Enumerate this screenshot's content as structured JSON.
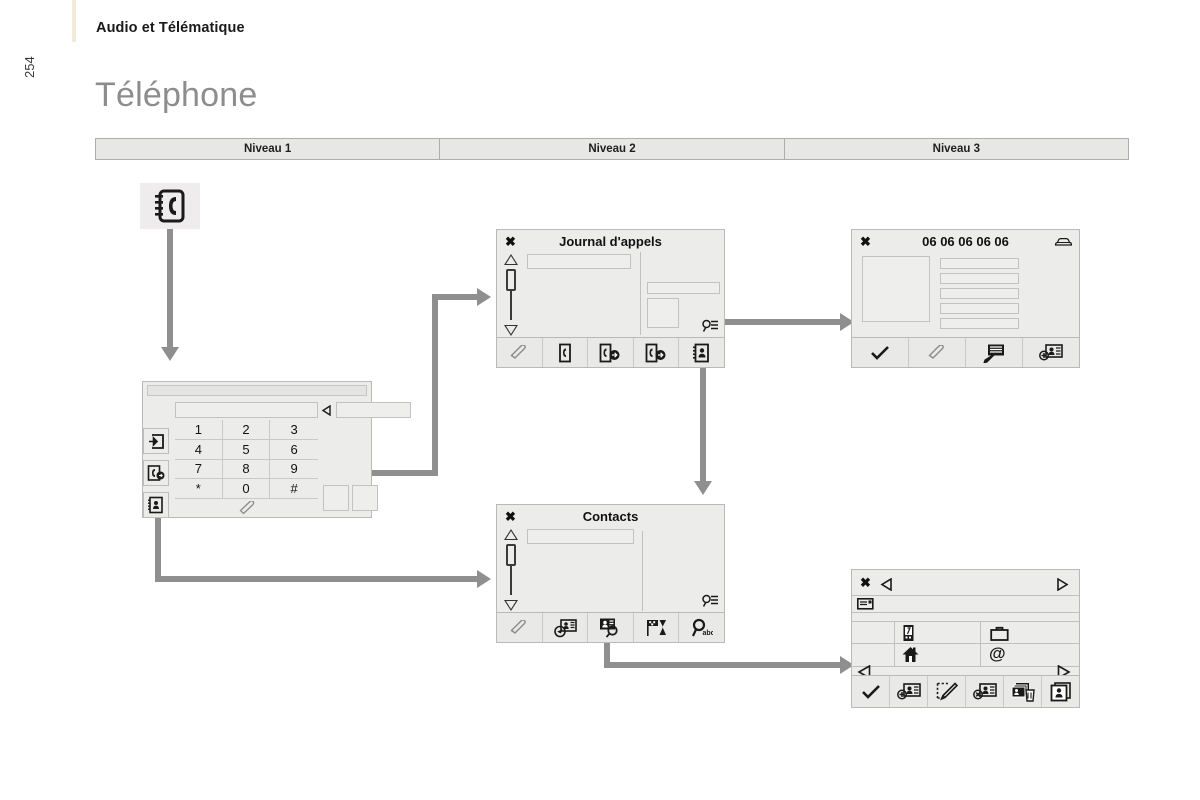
{
  "header": {
    "breadcrumb": "Audio et Télématique",
    "page_number": "254",
    "title": "Téléphone"
  },
  "levels": {
    "columns": [
      "Niveau 1",
      "Niveau 2",
      "Niveau 3"
    ]
  },
  "accent_color": "#f3ead8",
  "connector_color": "#8f8f8f",
  "screen_bg": "#ececeb",
  "level1": {
    "app_icon": "phonebook-icon",
    "keypad": {
      "name": "telephone-keypad-screen",
      "keys": [
        "1",
        "2",
        "3",
        "4",
        "5",
        "6",
        "7",
        "8",
        "9",
        "*",
        "0",
        "#"
      ],
      "call_button_icon": "handset-icon",
      "back_arrow_icon": "back-triangle-icon",
      "side_buttons": [
        {
          "icon": "dial-entry-icon",
          "name": "dial-entry-button"
        },
        {
          "icon": "call-log-icon",
          "name": "call-log-button"
        },
        {
          "icon": "contacts-book-icon",
          "name": "contacts-book-button"
        }
      ]
    }
  },
  "level2": {
    "call_log": {
      "title": "Journal d'appels",
      "close_icon": "close-icon",
      "scroll_icon": "scrollbar",
      "detail_icon": "search-list-icon",
      "toolbar": [
        {
          "icon": "handset-icon",
          "name": "call-button"
        },
        {
          "icon": "call-list-icon",
          "name": "all-calls-button"
        },
        {
          "icon": "incoming-call-icon",
          "name": "incoming-calls-button"
        },
        {
          "icon": "outgoing-call-icon",
          "name": "outgoing-calls-button"
        },
        {
          "icon": "contacts-book-icon",
          "name": "contacts-button"
        }
      ]
    },
    "contacts": {
      "title": "Contacts",
      "close_icon": "close-icon",
      "detail_icon": "search-list-icon",
      "toolbar": [
        {
          "icon": "handset-icon",
          "name": "call-button"
        },
        {
          "icon": "send-contact-icon",
          "name": "send-contact-button"
        },
        {
          "icon": "search-contact-icon",
          "name": "search-contact-button"
        },
        {
          "icon": "sort-contacts-icon",
          "name": "sort-contacts-button"
        },
        {
          "icon": "search-abc-icon",
          "name": "alpha-search-button",
          "label": "abc"
        }
      ]
    }
  },
  "level3": {
    "call_detail": {
      "title": "06 06 06 06 06",
      "close_icon": "close-icon",
      "status_icon": "car-icon",
      "toolbar": [
        {
          "icon": "check-icon",
          "name": "validate-button"
        },
        {
          "icon": "handset-icon",
          "name": "call-button"
        },
        {
          "icon": "edit-number-icon",
          "name": "edit-number-button"
        },
        {
          "icon": "add-contact-icon",
          "name": "add-contact-button"
        }
      ]
    },
    "contact_detail": {
      "close_icon": "close-icon",
      "prev_icon": "prev-arrow-icon",
      "next_icon": "next-arrow-icon",
      "name_field_icon": "name-card-icon",
      "categories": [
        {
          "icon": "mobile-phone-icon",
          "name": "mobile-category"
        },
        {
          "icon": "briefcase-icon",
          "name": "work-category"
        },
        {
          "icon": "house-icon",
          "name": "home-category"
        },
        {
          "icon": "at-sign-icon",
          "name": "email-category"
        }
      ],
      "pager_prev_icon": "prev-arrow-icon",
      "pager_next_icon": "next-arrow-icon",
      "toolbar": [
        {
          "icon": "check-icon",
          "name": "validate-button"
        },
        {
          "icon": "add-contact-icon",
          "name": "add-contact-button"
        },
        {
          "icon": "edit-contact-icon",
          "name": "edit-contact-button"
        },
        {
          "icon": "delete-contact-icon",
          "name": "delete-contact-button"
        },
        {
          "icon": "delete-all-contacts-icon",
          "name": "delete-all-button"
        },
        {
          "icon": "contact-memory-icon",
          "name": "memory-button"
        }
      ]
    }
  }
}
